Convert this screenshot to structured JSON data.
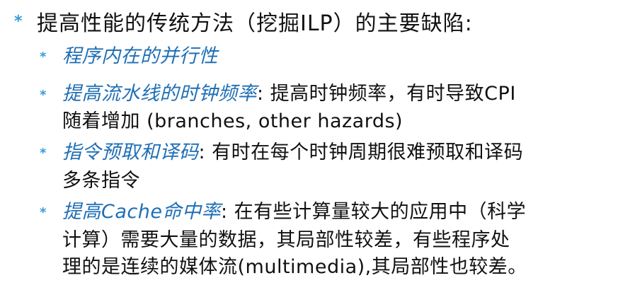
{
  "main_point": {
    "text": "提高性能的传统方法（挖掘ILP）的主要缺陷:"
  },
  "sub_points": [
    {
      "emphasis": "程序内在的并行性",
      "rest_line1": "",
      "line2": ""
    },
    {
      "emphasis": "提高流水线的时钟频率",
      "rest_line1": ": 提高时钟频率，有时导致CPI",
      "line2": "随着增加 (branches, other hazards)"
    },
    {
      "emphasis": "指令预取和译码",
      "rest_line1": ": 有时在每个时钟周期很难预取和译码",
      "line2": "多条指令"
    },
    {
      "emphasis": "提高Cache命中率",
      "rest_line1": ": 在有些计算量较大的应用中（科学",
      "line2": "计算）需要大量的数据，其局部性较差，有些程序处",
      "line3": "理的是连续的媒体流(multimedia),其局部性也较差。"
    }
  ],
  "colors": {
    "bullet": "#3a9ad9",
    "emphasis": "#1f6fb5",
    "text": "#111111"
  }
}
